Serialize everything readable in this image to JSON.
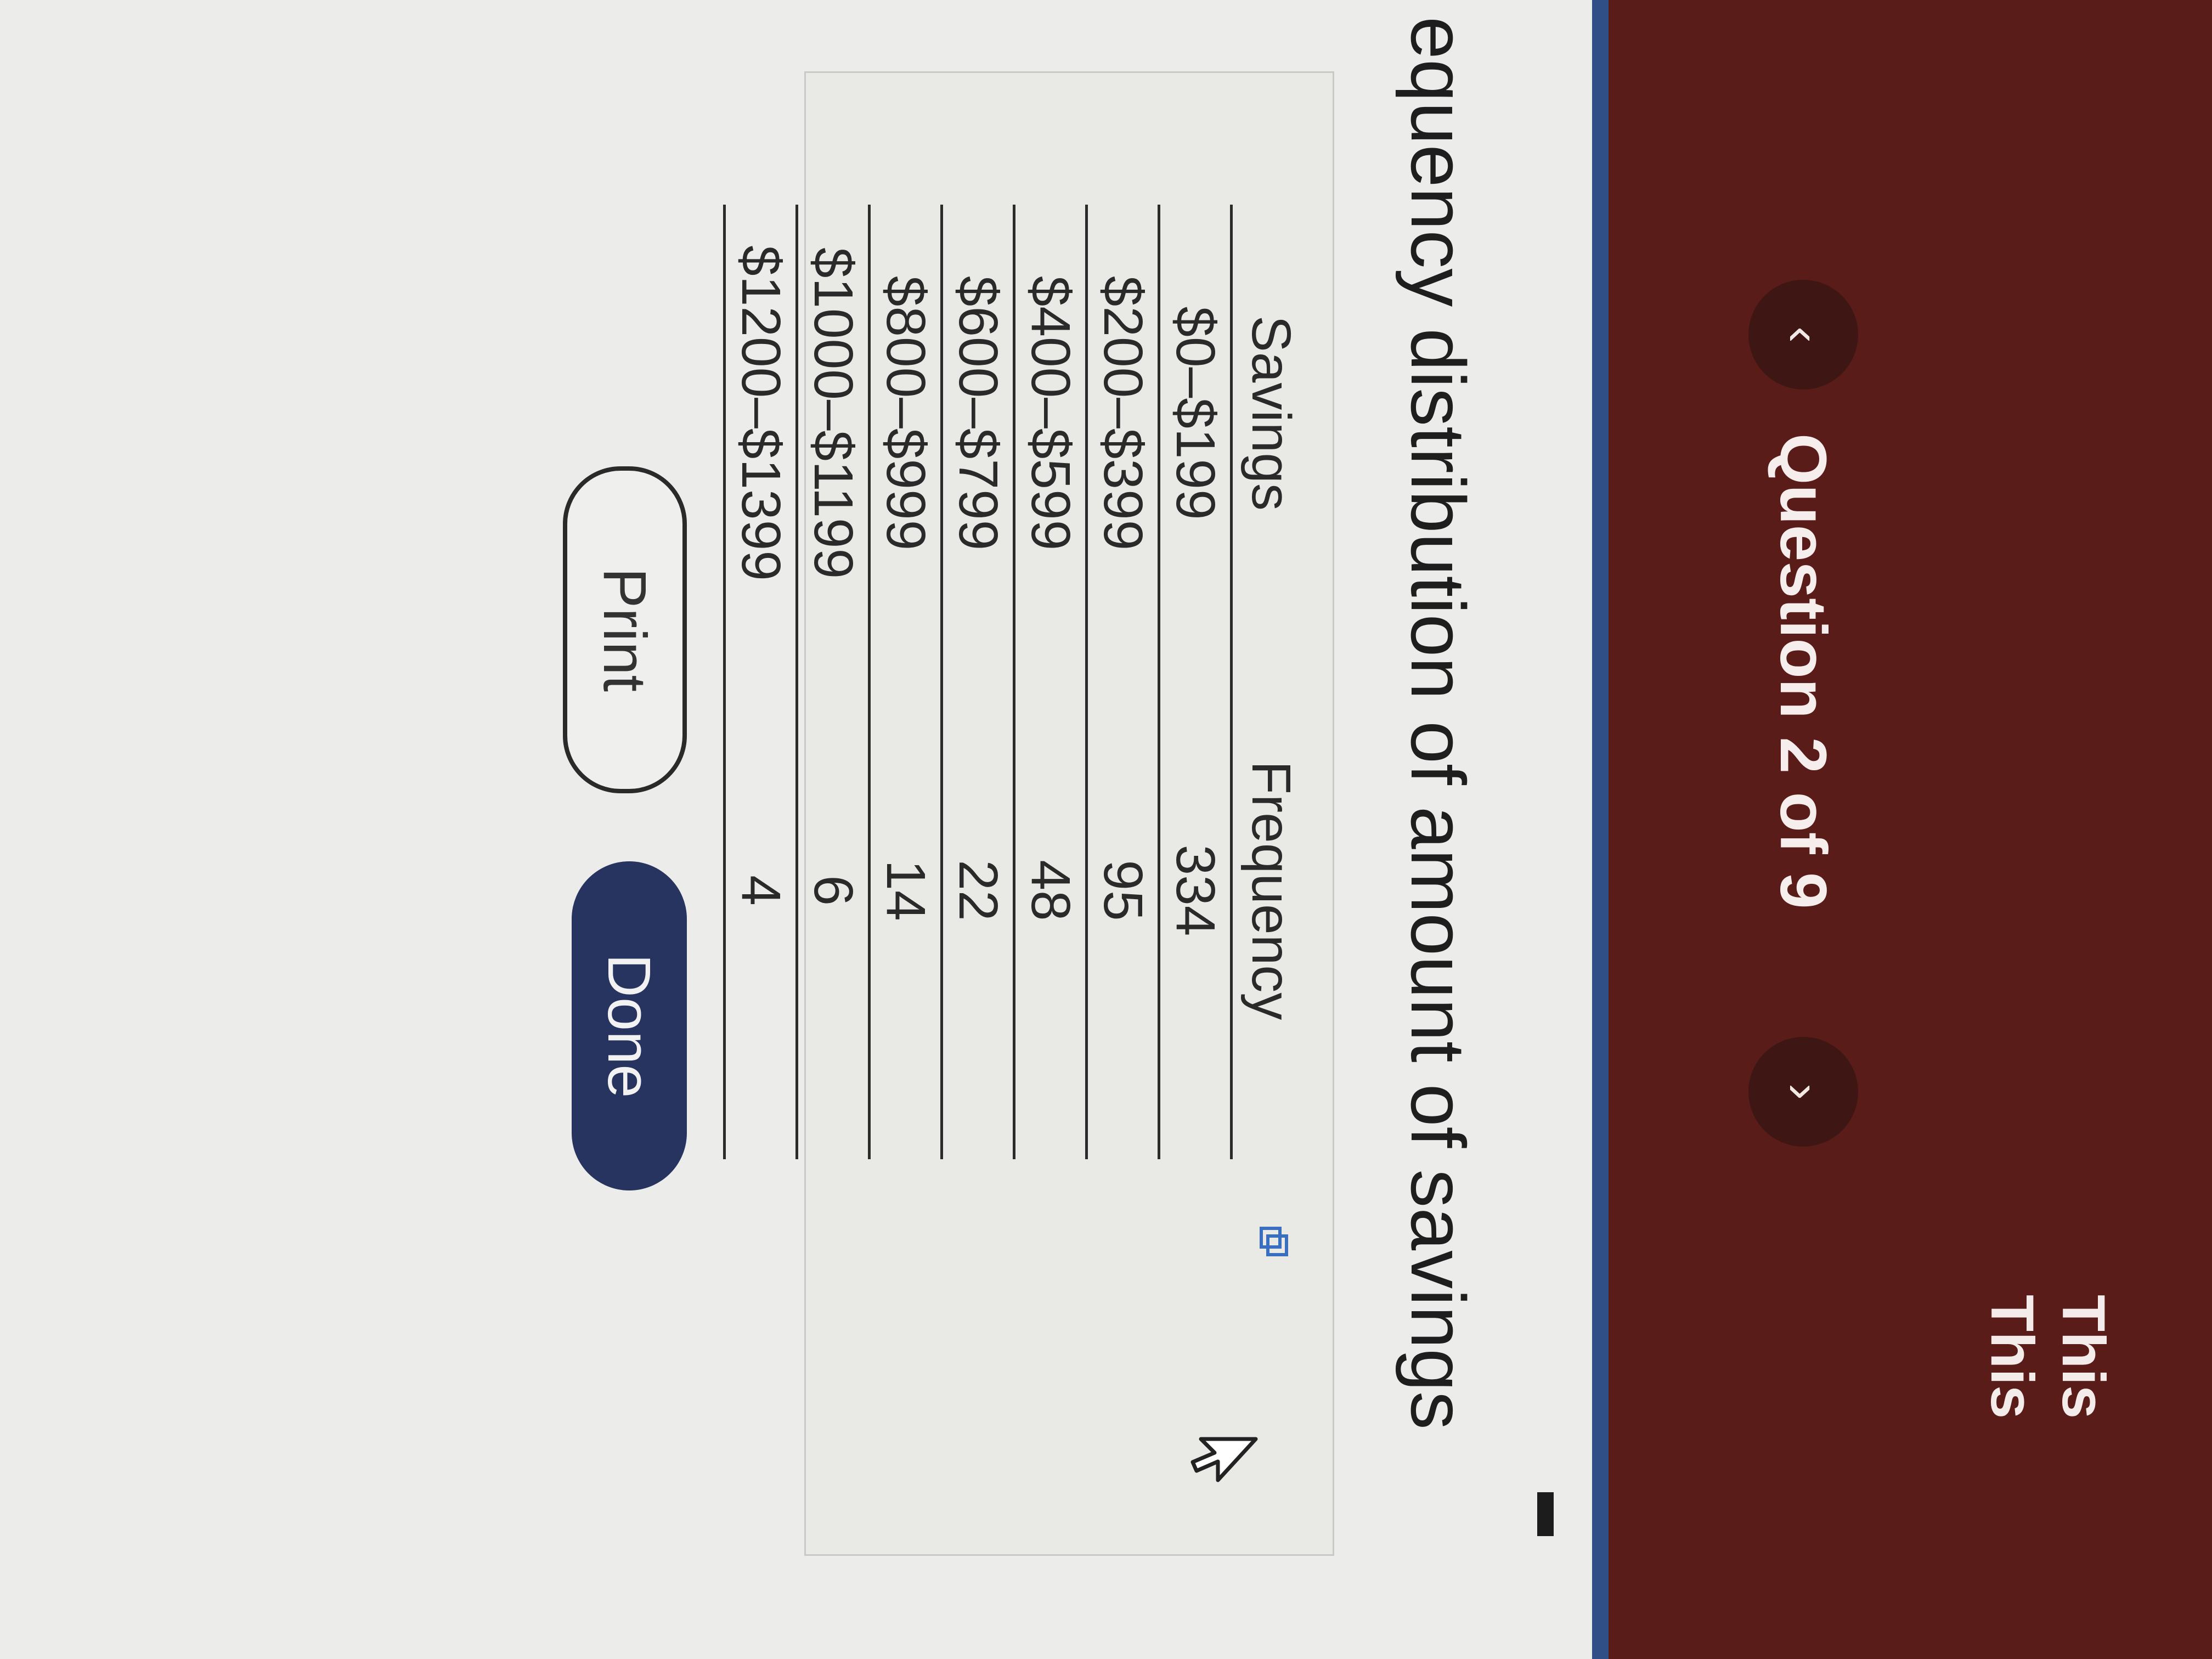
{
  "header": {
    "prev_label": "‹",
    "question_label": "Question 2 of 9",
    "next_label": "›",
    "this_line_1": "This",
    "this_line_2": "This"
  },
  "page": {
    "title": "equency distribution of amount of savings"
  },
  "table": {
    "headers": [
      "Savings",
      "Frequency"
    ],
    "rows": [
      [
        "$0–$199",
        "334"
      ],
      [
        "$200–$399",
        "95"
      ],
      [
        "$400–$599",
        "48"
      ],
      [
        "$600–$799",
        "22"
      ],
      [
        "$800–$999",
        "14"
      ],
      [
        "$1000–$1199",
        "6"
      ],
      [
        "$1200–$1399",
        "4"
      ]
    ]
  },
  "buttons": {
    "print_label": "Print",
    "done_label": "Done"
  },
  "colors": {
    "header_bg": "#5a1c18",
    "accent_blue": "#2f4f86",
    "done_button": "#27345f"
  },
  "icons": {
    "copy": "copy-icon",
    "cursor": "cursor-arrow-icon"
  }
}
